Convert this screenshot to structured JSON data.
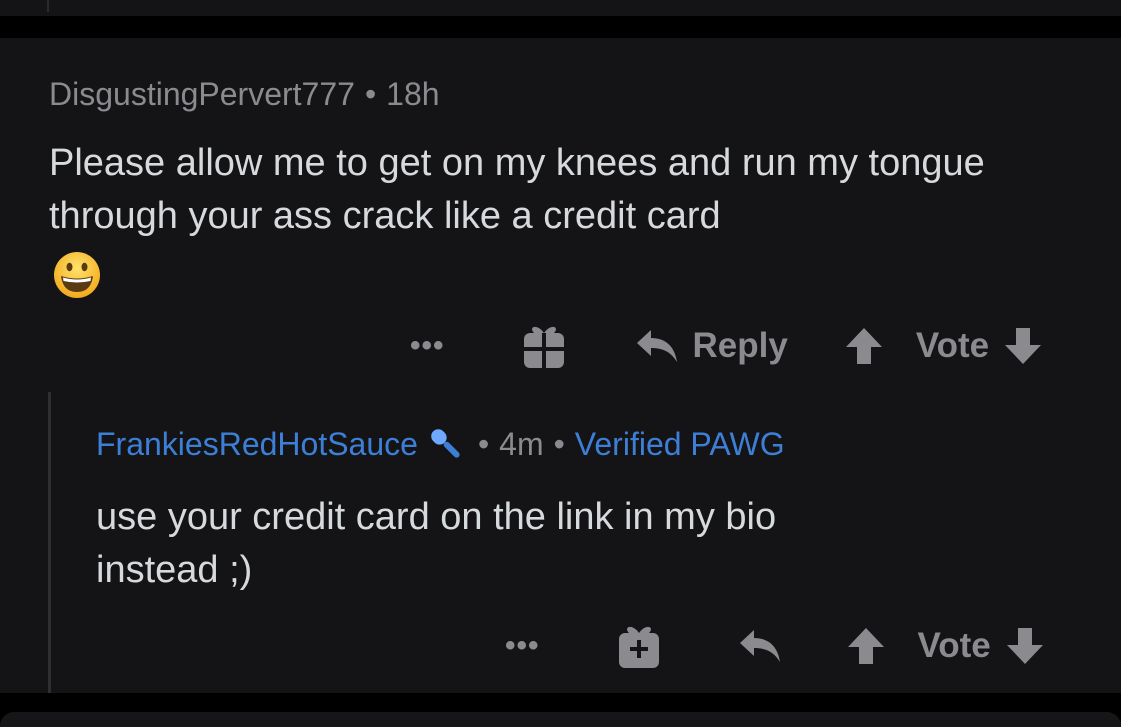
{
  "comment1": {
    "username": "DisgustingPervert777",
    "separator": "•",
    "time": "18h",
    "body": "Please allow me to get on my knees and run my tongue through your ass crack like a credit card",
    "emoji_icon": "grinning-face-emoji",
    "actions": {
      "more": "•••",
      "gift_icon": "gift-icon",
      "reply_icon": "reply-arrow-icon",
      "reply_label": "Reply",
      "upvote_icon": "upvote-arrow-icon",
      "vote_label": "Vote",
      "downvote_icon": "downvote-arrow-icon"
    }
  },
  "comment2": {
    "username": "FrankiesRedHotSauce",
    "badge_icon": "microphone-icon",
    "separator": "•",
    "time": "4m",
    "flair": "Verified PAWG",
    "body_line1": "use your credit card on the link in my bio",
    "body_line2": "instead ;)",
    "actions": {
      "more": "•••",
      "gift_icon": "gift-icon",
      "reply_icon": "reply-arrow-icon",
      "upvote_icon": "upvote-arrow-icon",
      "vote_label": "Vote",
      "downvote_icon": "downvote-arrow-icon"
    }
  },
  "colors": {
    "background": "#000000",
    "card": "#141416",
    "text": "#d7dadc",
    "meta": "#8a8a8f",
    "accent_blue": "#3d7fd6"
  }
}
